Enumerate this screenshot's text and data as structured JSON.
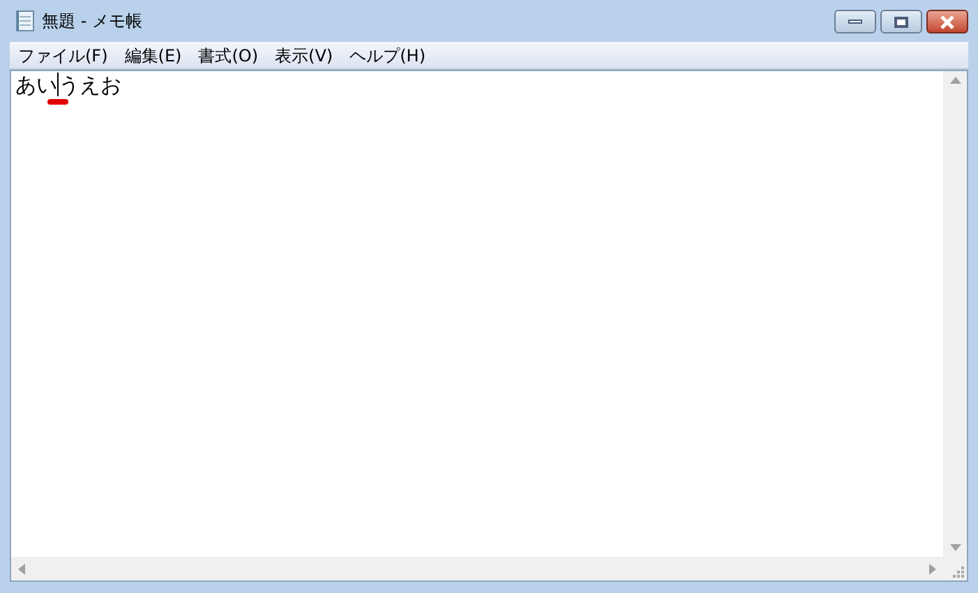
{
  "window": {
    "title": "無題 - メモ帳"
  },
  "menu": [
    {
      "label": "ファイル(F)"
    },
    {
      "label": "編集(E)"
    },
    {
      "label": "書式(O)"
    },
    {
      "label": "表示(V)"
    },
    {
      "label": "ヘルプ(H)"
    }
  ],
  "editor": {
    "text_before_caret": "あい",
    "text_after_caret": "うえお"
  }
}
